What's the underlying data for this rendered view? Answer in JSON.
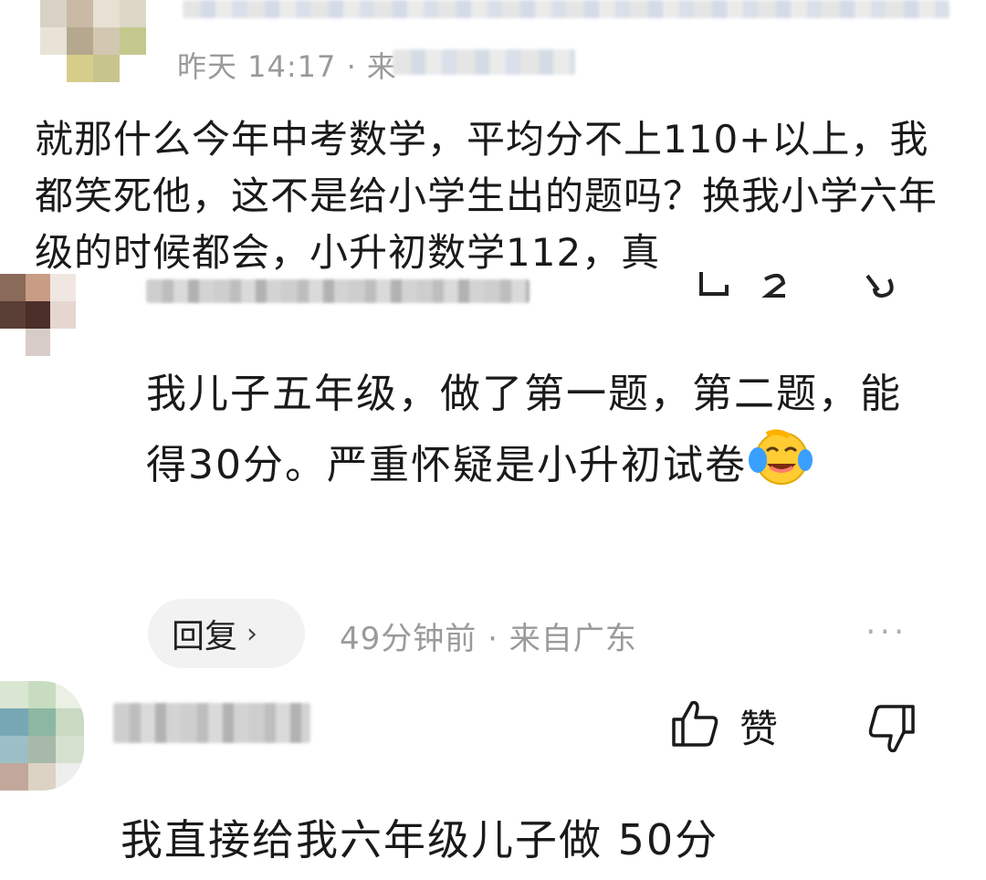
{
  "top_comment": {
    "meta": "昨天 14:17 · 来",
    "text": "就那什么今年中考数学，平均分不上110+以上，我都笑死他，这不是给小学生出的题吗？换我小学六年级的时候都会，小升初数学112，真"
  },
  "reply_comment": {
    "text": "我儿子五年级，做了第一题，第二题，能得30分。严重怀疑是小升初试卷",
    "emoji": "laughing-crying-emoji",
    "reply_label": "回复",
    "time": "49分钟前",
    "location": "来自广东",
    "more": "···"
  },
  "actions": {
    "like_label": "赞",
    "like_icon": "thumbs-up-icon",
    "dislike_icon": "thumbs-down-icon"
  },
  "third_comment": {
    "text": "我直接给我六年级儿子做 50分"
  },
  "colors": {
    "text": "#1a1a1a",
    "meta": "#9a9a9a",
    "reply_bg": "#f2f2f2"
  }
}
